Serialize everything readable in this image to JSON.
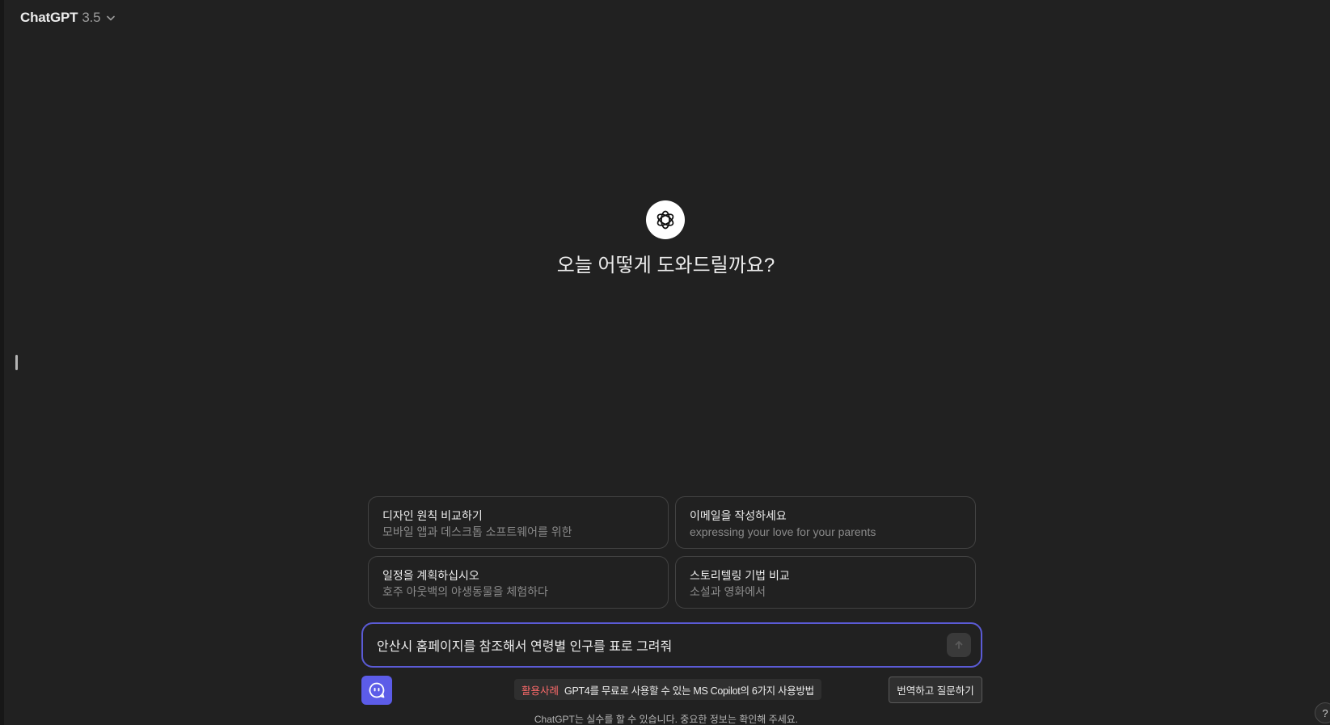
{
  "header": {
    "model_name": "ChatGPT",
    "model_version": "3.5",
    "chevron_icon": "chevron-down-icon"
  },
  "hero": {
    "logo_icon": "openai-logo-icon",
    "greeting": "오늘 어떻게 도와드릴까요?"
  },
  "suggestions": [
    {
      "title": "디자인 원칙 비교하기",
      "subtitle": "모바일 앱과 데스크톱 소프트웨어를 위한"
    },
    {
      "title": "이메일을 작성하세요",
      "subtitle": "expressing your love for your parents"
    },
    {
      "title": "일정을 계획하십시오",
      "subtitle": "호주 아웃백의 야생동물을 체험하다"
    },
    {
      "title": "스토리텔링 기법 비교",
      "subtitle": "소설과 영화에서"
    }
  ],
  "composer": {
    "value": "안산시 홈페이지를 참조해서 연령별 인구를 표로 그려줘",
    "send_icon": "send-arrow-icon",
    "border_color": "#5b5bd6"
  },
  "extension": {
    "icon": "chat-bubble-icon",
    "accent_color": "#5c5ce8",
    "promo_tag": "활용사례",
    "promo_text": "GPT4를 무료로 사용할 수 있는 MS Copilot의 6가지 사용방법",
    "translate_label": "번역하고 질문하기"
  },
  "footer": {
    "disclaimer": "ChatGPT는 실수를 할 수 있습니다. 중요한 정보는 확인해 주세요.",
    "help_label": "?"
  }
}
